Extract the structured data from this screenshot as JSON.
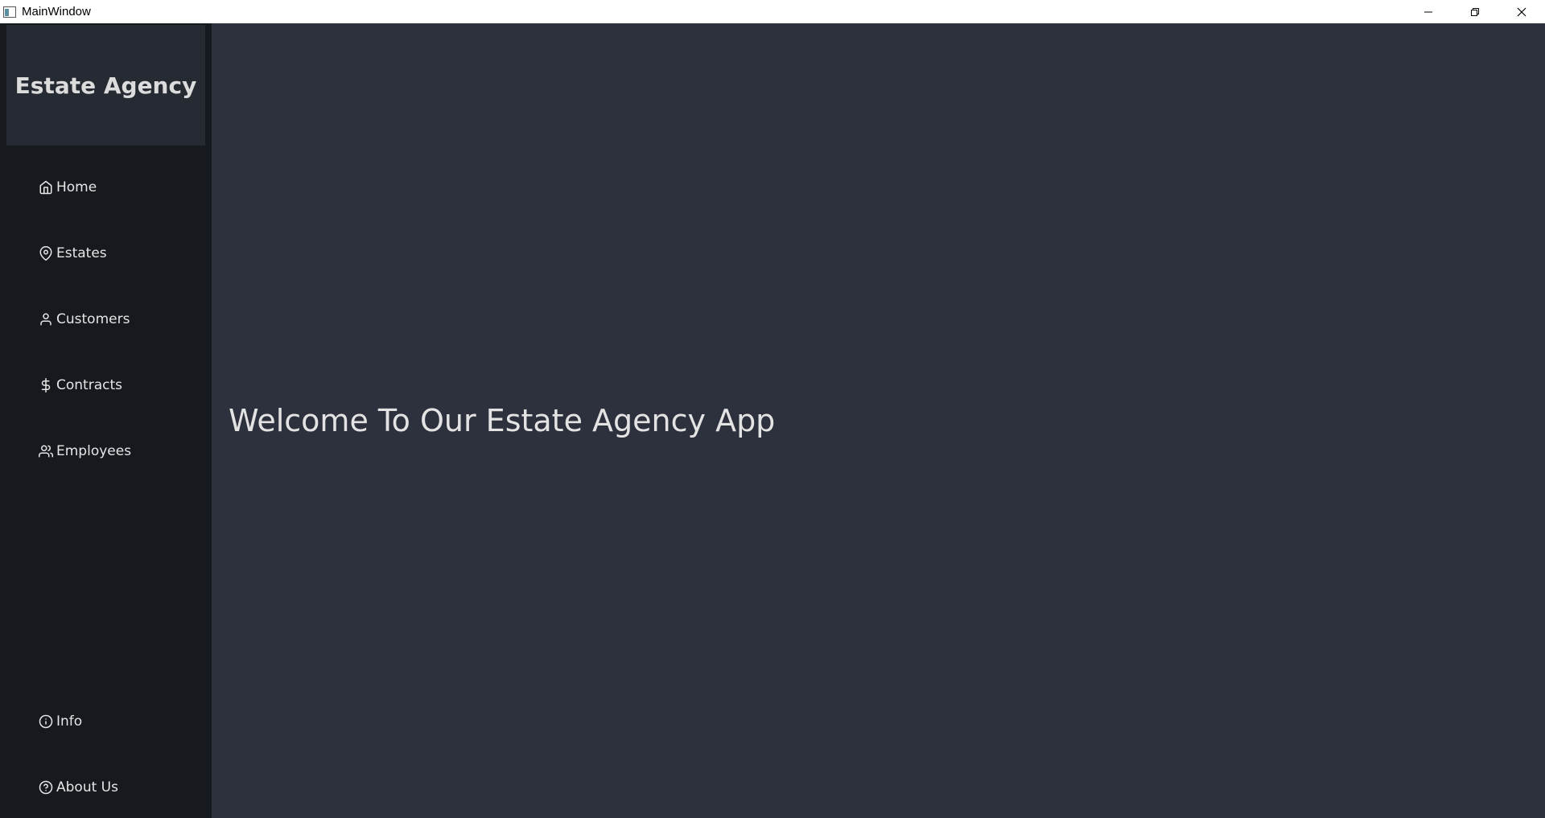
{
  "window": {
    "title": "MainWindow"
  },
  "sidebar": {
    "brand": "Estate Agency",
    "items": [
      {
        "label": "Home",
        "icon": "home-icon"
      },
      {
        "label": "Estates",
        "icon": "map-pin-icon"
      },
      {
        "label": "Customers",
        "icon": "user-icon"
      },
      {
        "label": "Contracts",
        "icon": "dollar-icon"
      },
      {
        "label": "Employees",
        "icon": "users-icon"
      }
    ],
    "bottom_items": [
      {
        "label": "Info",
        "icon": "info-icon"
      },
      {
        "label": "About Us",
        "icon": "help-circle-icon"
      }
    ]
  },
  "main": {
    "welcome": "Welcome To Our Estate Agency App"
  },
  "colors": {
    "sidebar_bg": "#16191e",
    "brand_bg": "#262a33",
    "main_bg": "#2d313d",
    "text": "#e3e3e3"
  }
}
